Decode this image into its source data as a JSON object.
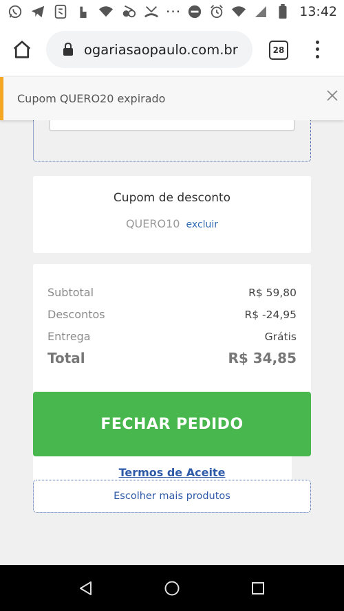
{
  "status_bar": {
    "time": "13:42",
    "overflow": "···",
    "icons_left": [
      "whatsapp-icon",
      "telegram-icon",
      "app-icon",
      "notification-icon",
      "wifi-icon",
      "mute-icon",
      "missed-call-icon"
    ],
    "icons_right": [
      "do-not-disturb-icon",
      "alarm-icon",
      "wifi-icon",
      "signal-icon",
      "battery-icon"
    ]
  },
  "browser": {
    "url": "ogariasaopaulo.com.br",
    "tab_count": "28"
  },
  "toast": {
    "message": "Cupom QUERO20 expirado",
    "accent_color": "#f5a623"
  },
  "coupon": {
    "title": "Cupom de desconto",
    "code": "QUERO10",
    "remove_label": "excluir"
  },
  "summary": {
    "subtotal_label": "Subtotal",
    "subtotal_value": "R$ 59,80",
    "discount_label": "Descontos",
    "discount_value": "R$ -24,95",
    "delivery_label": "Entrega",
    "delivery_value": "Grátis",
    "total_label": "Total",
    "total_value": "R$ 34,85"
  },
  "actions": {
    "checkout_label": "FECHAR PEDIDO",
    "checkout_color": "#48b74d",
    "terms_label": "Termos de Aceite",
    "more_products_label": "Escolher mais produtos"
  }
}
